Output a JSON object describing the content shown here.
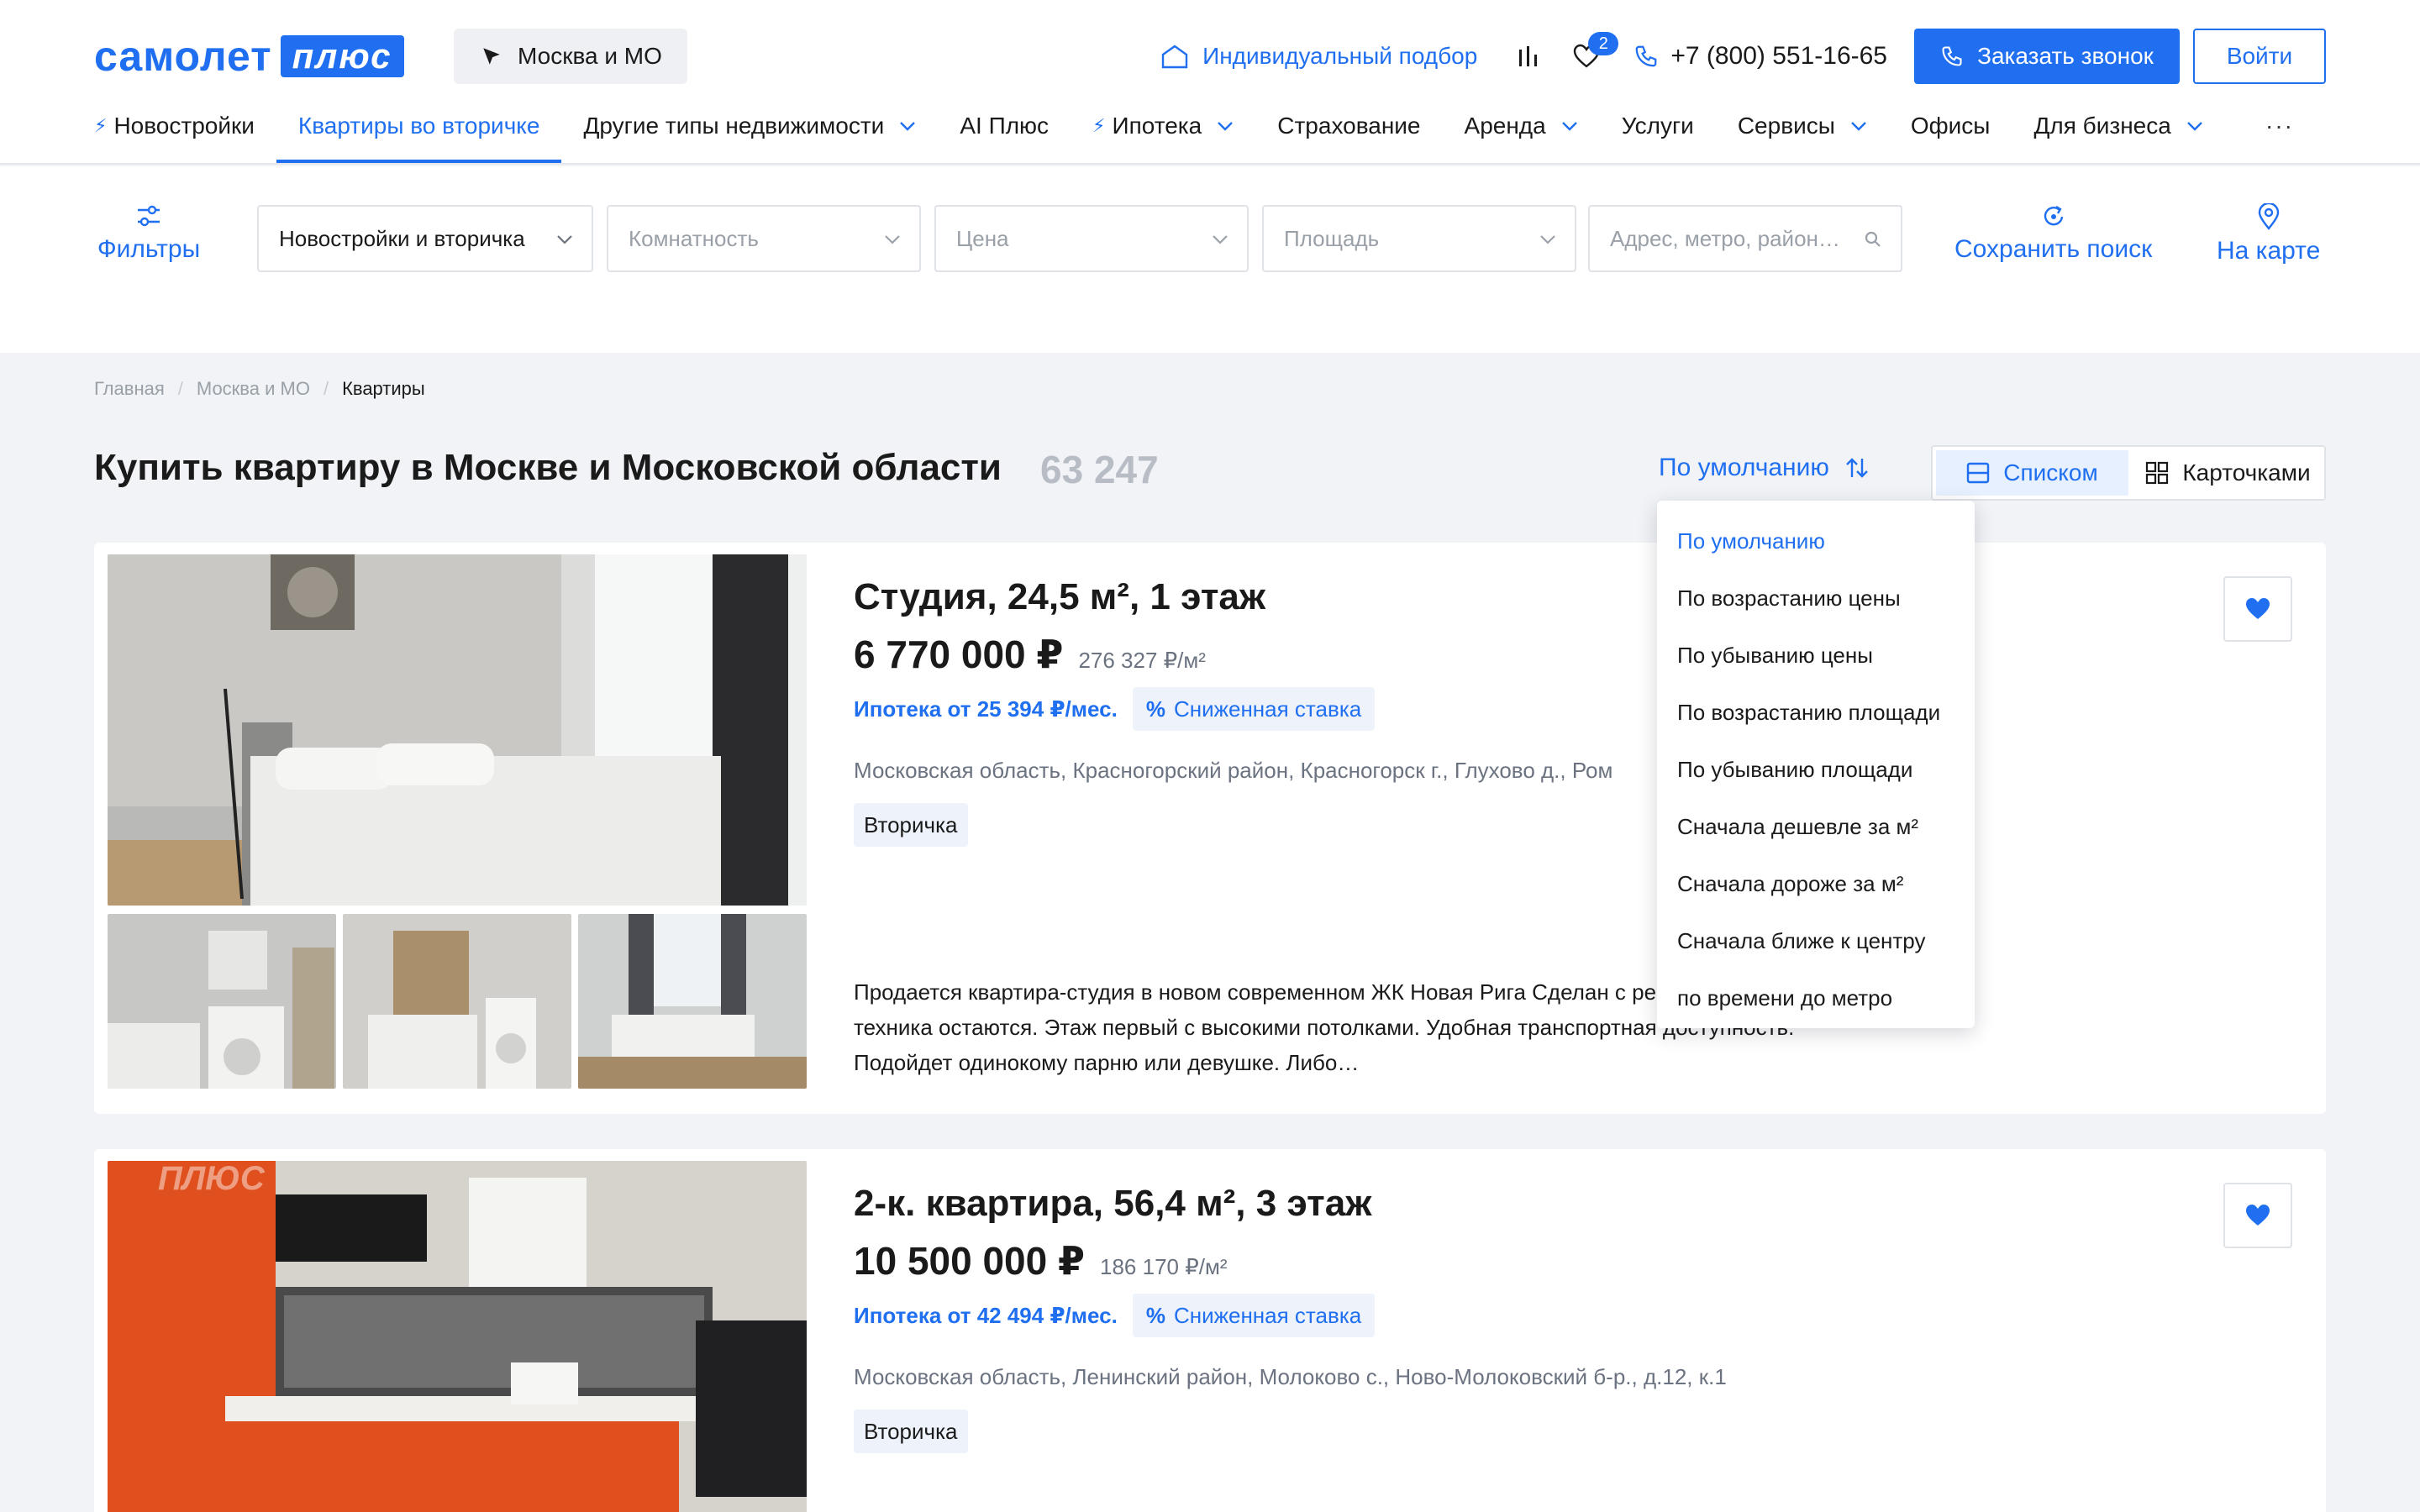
{
  "header": {
    "logo": {
      "word": "самолет",
      "plus": "плюс"
    },
    "city": "Москва и МО",
    "individual_selection": "Индивидуальный подбор",
    "favorites_count": "2",
    "phone": "+7 (800) 551-16-65",
    "call_button": "Заказать звонок",
    "login_button": "Войти",
    "nav": [
      {
        "label": "Новостройки",
        "bolt": true,
        "chevron": false
      },
      {
        "label": "Квартиры во вторичке",
        "bolt": false,
        "chevron": false,
        "active": true
      },
      {
        "label": "Другие типы недвижимости",
        "bolt": false,
        "chevron": true
      },
      {
        "label": "AI Плюс",
        "bolt": false,
        "chevron": false
      },
      {
        "label": "Ипотека",
        "bolt": true,
        "chevron": true
      },
      {
        "label": "Страхование",
        "bolt": false,
        "chevron": false
      },
      {
        "label": "Аренда",
        "bolt": false,
        "chevron": true
      },
      {
        "label": "Услуги",
        "bolt": false,
        "chevron": false
      },
      {
        "label": "Сервисы",
        "bolt": false,
        "chevron": true
      },
      {
        "label": "Офисы",
        "bolt": false,
        "chevron": false
      },
      {
        "label": "Для бизнеса",
        "bolt": false,
        "chevron": true
      }
    ],
    "nav_more": "···"
  },
  "filters": {
    "filters_label": "Фильтры",
    "type_value": "Новостройки и вторичка",
    "rooms_placeholder": "Комнатность",
    "price_placeholder": "Цена",
    "area_placeholder": "Площадь",
    "address_placeholder": "Адрес, метро, район…",
    "save_search": "Сохранить поиск",
    "on_map": "На карте"
  },
  "breadcrumb": [
    "Главная",
    "Москва и МО",
    "Квартиры"
  ],
  "title": "Купить квартиру в Москве и Московской области",
  "count": "63 247",
  "sort": {
    "current": "По умолчанию",
    "options": [
      "По умолчанию",
      "По возрастанию цены",
      "По убыванию цены",
      "По возрастанию площади",
      "По убыванию площади",
      "Сначала дешевле за м²",
      "Сначала дороже за м²",
      "Сначала ближе к центру",
      "по времени до метро"
    ]
  },
  "view": {
    "list": "Списком",
    "cards": "Карточками"
  },
  "listings": [
    {
      "title": "Студия, 24,5 м², 1 этаж",
      "price": "6 770 000 ₽",
      "price_per_m": "276 327 ₽/м²",
      "mortgage": "Ипотека от 25 394 ₽/мес.",
      "rate": "Сниженная ставка",
      "address": "Московская область, Красногорский район, Красногорск г., Глухово д., Ром",
      "tag": "Вторичка",
      "description": "Продается квартира-студия в новом современном ЖК Новая Рига Сделан с ремонтом Вся мебель и техника остаются. Этаж первый с высокими потолками. Удобная транспортная доступность. Подойдет одинокому парню или девушке. Либо…"
    },
    {
      "title": "2-к. квартира, 56,4 м², 3 этаж",
      "price": "10 500 000 ₽",
      "price_per_m": "186 170 ₽/м²",
      "mortgage": "Ипотека от 42 494 ₽/мес.",
      "rate": "Сниженная ставка",
      "address": "Московская область, Ленинский район, Молоково с., Ново-Молоковский б-р., д.12, к.1",
      "tag": "Вторичка",
      "watermark": "ПЛЮС"
    }
  ],
  "colors": {
    "accent": "#1f6ff0",
    "background": "#f1f3f6",
    "muted": "#9aa0a8"
  }
}
